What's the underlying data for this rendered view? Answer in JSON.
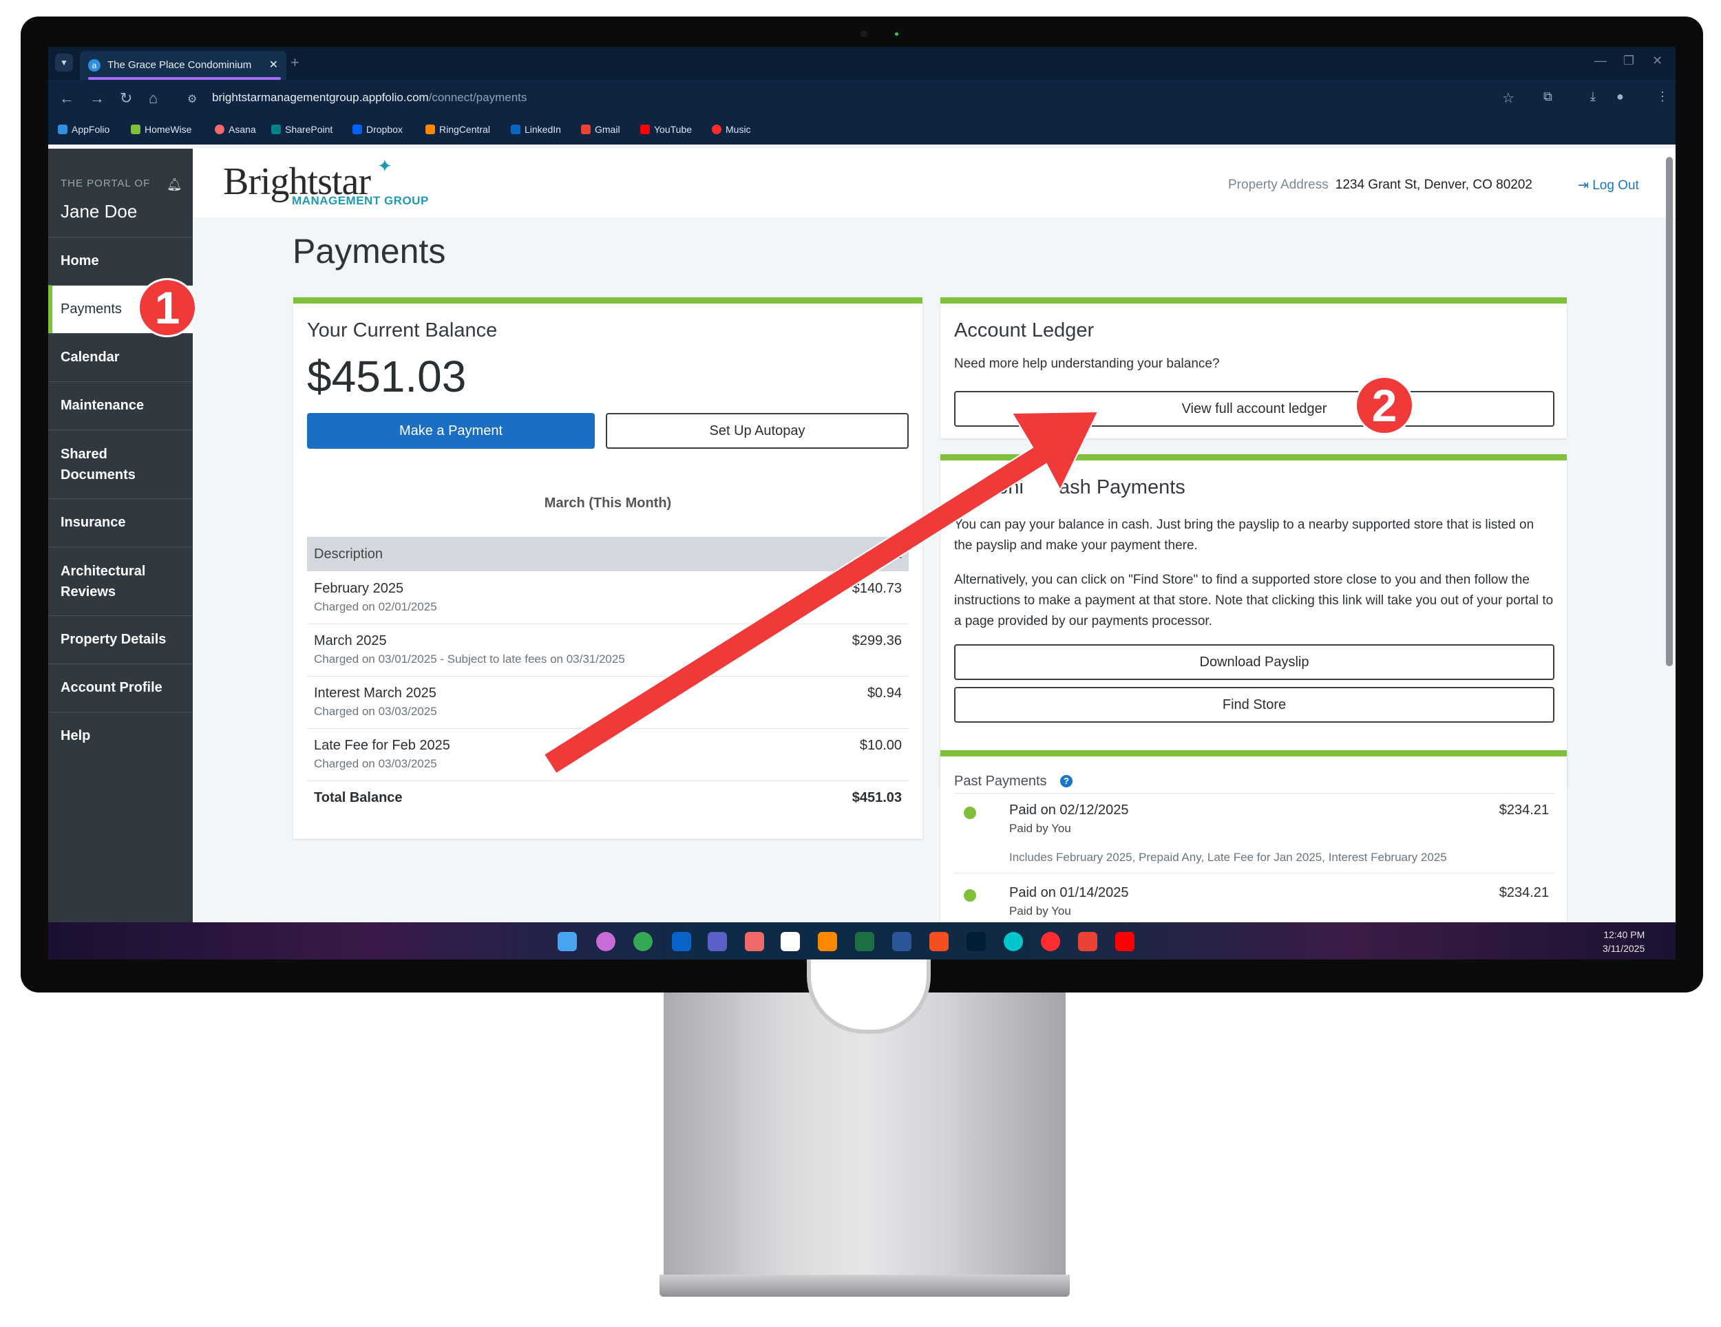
{
  "browser": {
    "tab_title": "The Grace Place Condominium",
    "tab_close": "✕",
    "url_host": "brightstarmanagementgroup.appfolio.com",
    "url_path": "/connect/payments",
    "bookmarks": [
      "AppFolio",
      "HomeWise",
      "Asana",
      "SharePoint",
      "Dropbox",
      "RingCentral",
      "LinkedIn",
      "Gmail",
      "YouTube",
      "Music"
    ]
  },
  "sidebar": {
    "portal_label": "THE PORTAL OF",
    "user_name": "Jane Doe",
    "items": [
      {
        "label": "Home"
      },
      {
        "label": "Payments"
      },
      {
        "label": "Calendar"
      },
      {
        "label": "Maintenance"
      },
      {
        "label": "Shared Documents"
      },
      {
        "label": "Insurance"
      },
      {
        "label": "Architectural Reviews"
      },
      {
        "label": "Property Details"
      },
      {
        "label": "Account Profile"
      },
      {
        "label": "Help"
      }
    ],
    "active": "Payments"
  },
  "header": {
    "logo_main": "Brightstar",
    "logo_sub": "MANAGEMENT GROUP",
    "property_label": "Property Address",
    "property_value": "1234 Grant St, Denver, CO 80202",
    "logout_label": "Log Out"
  },
  "page": {
    "title": "Payments"
  },
  "balance_card": {
    "title": "Your Current Balance",
    "amount": "$451.03",
    "pay_button": "Make a Payment",
    "autopay_button": "Set Up Autopay",
    "period_label": "March (This Month)",
    "col_description": "Description",
    "col_amount_fragment": "unt",
    "rows": [
      {
        "desc": "February 2025",
        "sub": "Charged on 02/01/2025",
        "amount": "$140.73"
      },
      {
        "desc": "March 2025",
        "sub": "Charged on 03/01/2025 - Subject to late fees on 03/31/2025",
        "amount": "$299.36"
      },
      {
        "desc": "Interest March 2025",
        "sub": "Charged on 03/03/2025",
        "amount": "$0.94"
      },
      {
        "desc": "Late Fee for Feb 2025",
        "sub": "Charged on 03/03/2025",
        "amount": "$10.00"
      }
    ],
    "total_label": "Total Balance",
    "total_amount": "$451.03"
  },
  "ledger_card": {
    "title": "Account Ledger",
    "help_text": "Need more help understanding your balance?",
    "button": "View full account ledger"
  },
  "cash_card": {
    "title_left": "ctroni",
    "title_right": "ash Payments",
    "para1": "You can pay your balance in cash. Just bring the payslip to a nearby supported store that is listed on the payslip and make your payment there.",
    "para2": "Alternatively, you can click on \"Find Store\" to find a supported store close to you and then follow the instructions to make a payment at that store. Note that clicking this link will take you out of your portal to a page provided by our payments processor.",
    "download_button": "Download Payslip",
    "find_button": "Find Store"
  },
  "past_payments": {
    "title": "Past Payments",
    "items": [
      {
        "title": "Paid on 02/12/2025",
        "by": "Paid by You",
        "amount": "$234.21",
        "note": "Includes February 2025, Prepaid Any, Late Fee for Jan 2025, Interest February 2025"
      },
      {
        "title": "Paid on 01/14/2025",
        "by": "Paid by You",
        "amount": "$234.21"
      }
    ]
  },
  "taskbar": {
    "time": "12:40 PM",
    "date": "3/11/2025"
  },
  "annotations": {
    "step1": "1",
    "step2": "2",
    "arrow_color": "#f03a3a"
  },
  "colors": {
    "accent_green": "#7fbf3a",
    "primary_blue": "#1a6fc4",
    "sidebar": "#30393f",
    "brand_teal": "#1f9ab0"
  }
}
